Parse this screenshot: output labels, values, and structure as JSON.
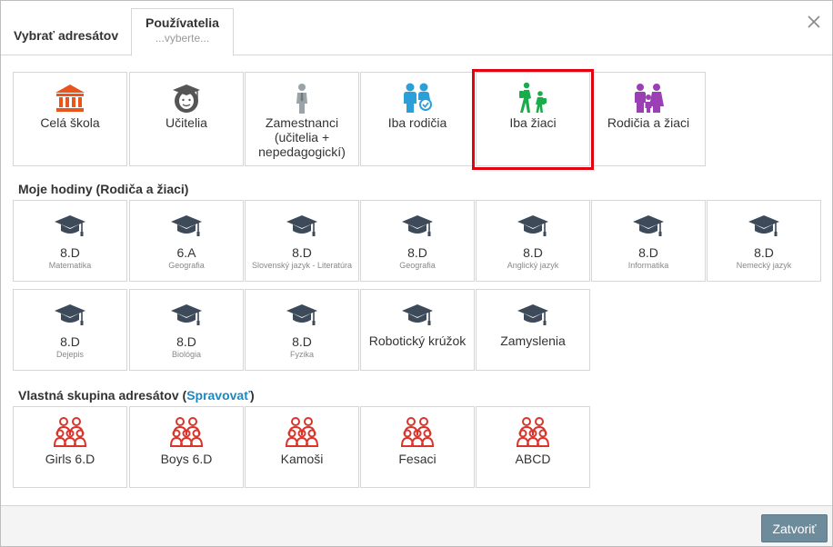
{
  "dialog": {
    "header_label": "Vybrať adresátov",
    "tab": {
      "title": "Používatelia",
      "subtitle": "...vyberte..."
    },
    "footer": {
      "close_button": "Zatvoriť"
    }
  },
  "recipient_types": [
    {
      "label": "Celá škola",
      "icon": "school-building-icon",
      "color": "#e8561e"
    },
    {
      "label": "Učitelia",
      "icon": "teacher-graduate-icon",
      "color": "#555555"
    },
    {
      "label": "Zamestnanci (učitelia + nepedagogickí)",
      "icon": "employee-icon",
      "color": "#9aa4a8"
    },
    {
      "label": "Iba rodičia",
      "icon": "parents-icon",
      "color": "#2a9fd8"
    },
    {
      "label": "Iba žiaci",
      "icon": "students-walking-icon",
      "color": "#1aab4b",
      "selected": true
    },
    {
      "label": "Rodičia a žiaci",
      "icon": "family-icon",
      "color": "#9b3fb5"
    }
  ],
  "my_classes": {
    "heading": "Moje hodiny (Rodiča a žiaci)",
    "items": [
      {
        "label": "8.D",
        "subject": "Matematika"
      },
      {
        "label": "6.A",
        "subject": "Geografia"
      },
      {
        "label": "8.D",
        "subject": "Slovenský jazyk - Literatúra"
      },
      {
        "label": "8.D",
        "subject": "Geografia"
      },
      {
        "label": "8.D",
        "subject": "Anglický jazyk"
      },
      {
        "label": "8.D",
        "subject": "Informatika"
      },
      {
        "label": "8.D",
        "subject": "Nemecký jazyk"
      },
      {
        "label": "8.D",
        "subject": "Dejepis"
      },
      {
        "label": "8.D",
        "subject": "Biológia"
      },
      {
        "label": "8.D",
        "subject": "Fyzika"
      },
      {
        "label": "Robotický krúžok",
        "subject": ""
      },
      {
        "label": "Zamyslenia",
        "subject": ""
      }
    ]
  },
  "custom_groups": {
    "heading_prefix": "Vlastná skupina adresátov (",
    "manage_link": "Spravovať",
    "heading_suffix": ")",
    "items": [
      {
        "label": "Girls 6.D"
      },
      {
        "label": "Boys 6.D"
      },
      {
        "label": "Kamoši"
      },
      {
        "label": "Fesaci"
      },
      {
        "label": "ABCD"
      }
    ]
  },
  "colors": {
    "mortarboard": "#3d4a59",
    "group": "#d9352c",
    "highlight": "#e3000f",
    "link": "#1a8ac4",
    "button": "#6e8b9c"
  }
}
